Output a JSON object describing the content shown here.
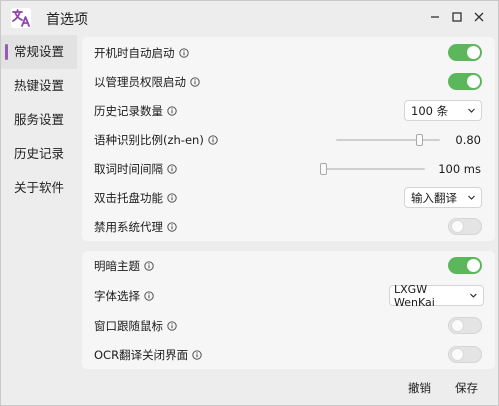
{
  "window": {
    "title": "首选项",
    "icons": {
      "logo": "translate-logo-icon",
      "minimize": "minimize-icon",
      "maximize": "maximize-icon",
      "close": "close-icon"
    },
    "colors": {
      "accent": "#9b59b6",
      "toggle_on": "#5cb65c"
    }
  },
  "sidebar": {
    "items": [
      {
        "label": "常规设置",
        "active": true
      },
      {
        "label": "热键设置",
        "active": false
      },
      {
        "label": "服务设置",
        "active": false
      },
      {
        "label": "历史记录",
        "active": false
      },
      {
        "label": "关于软件",
        "active": false
      }
    ]
  },
  "general": {
    "autostart": {
      "label": "开机时自动启动",
      "on": true
    },
    "admin_start": {
      "label": "以管理员权限启动",
      "on": true
    },
    "history_count": {
      "label": "历史记录数量",
      "value": "100 条"
    },
    "lang_ratio": {
      "label": "语种识别比例(zh-en)",
      "value": "0.80",
      "level": 0.8
    },
    "fetch_interval": {
      "label": "取词时间间隔",
      "value": "100 ms",
      "level": 0.0
    },
    "tray_double_click": {
      "label": "双击托盘功能",
      "value": "输入翻译"
    },
    "disable_proxy": {
      "label": "禁用系统代理",
      "on": false
    }
  },
  "appearance": {
    "dark_theme": {
      "label": "明暗主题",
      "on": true
    },
    "font": {
      "label": "字体选择",
      "value": "LXGW WenKai"
    },
    "follow_mouse": {
      "label": "窗口跟随鼠标",
      "on": false
    },
    "ocr_close": {
      "label": "OCR翻译关闭界面",
      "on": false
    }
  },
  "footer": {
    "cancel": "撤销",
    "save": "保存"
  }
}
